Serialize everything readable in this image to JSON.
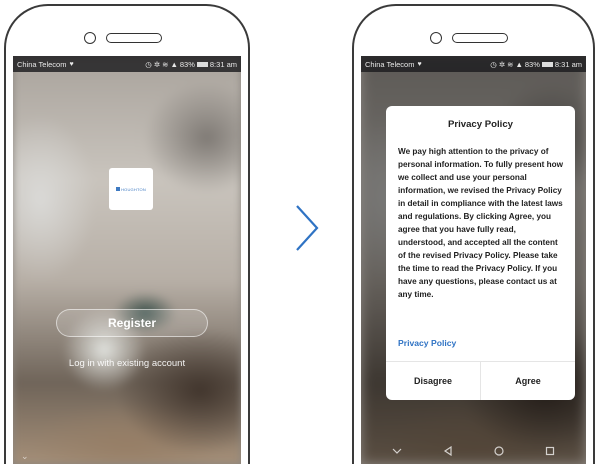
{
  "status_bar": {
    "carrier": "China Telecom",
    "battery": "83%",
    "time": "8:31 am"
  },
  "left_screen": {
    "logo_text": "HOUGHTON",
    "register_label": "Register",
    "login_label": "Log in with existing account",
    "nav_hint": "⌄"
  },
  "transition_icon": "chevron-right-icon",
  "right_screen": {
    "dialog": {
      "title": "Privacy Policy",
      "body": "We pay high attention to the privacy of personal information. To fully present how we collect and use your personal information, we revised the Privacy Policy in detail in compliance with the latest laws and regulations. By clicking Agree, you agree that you have fully read, understood, and accepted all the content of the revised Privacy Policy. Please take the time to read the Privacy Policy. If you have any questions, please contact us at any time.",
      "link": "Privacy Policy",
      "disagree": "Disagree",
      "agree": "Agree"
    },
    "nav_icons": [
      "chevron-down-icon",
      "back-icon",
      "home-icon",
      "recents-icon"
    ]
  },
  "colors": {
    "link": "#2f73c4",
    "logo": "#3e7ac2"
  }
}
